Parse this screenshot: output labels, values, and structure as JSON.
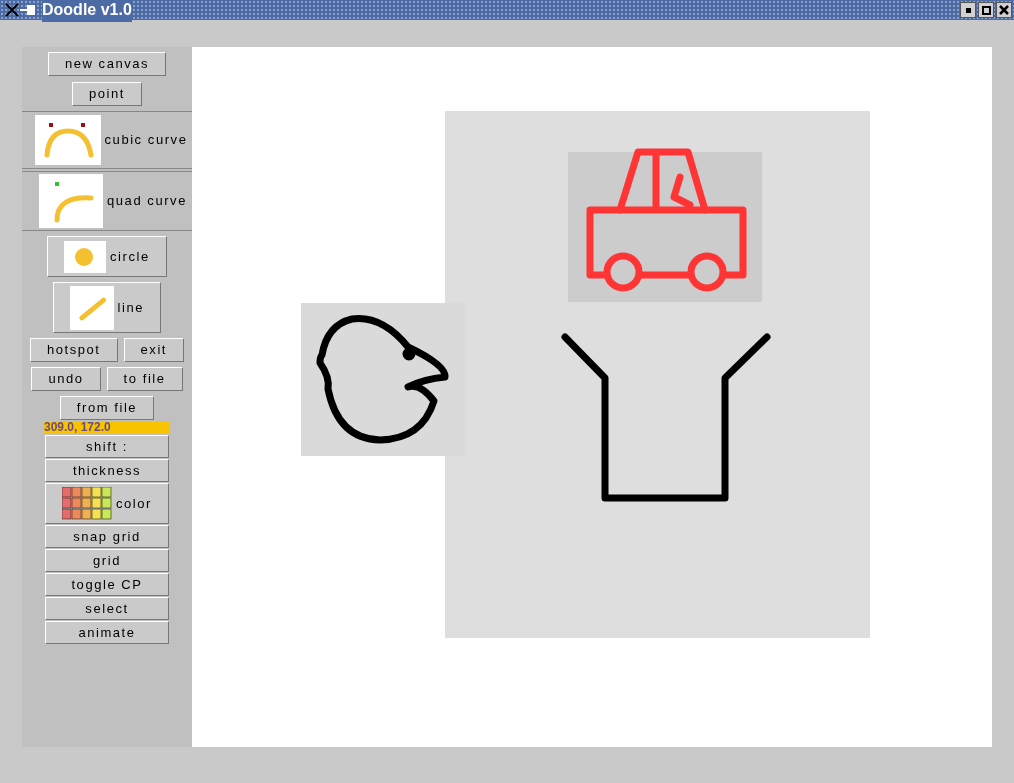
{
  "window": {
    "title": "Doodle v1.0"
  },
  "sidebar": {
    "groups": [
      [
        [
          {
            "kind": "button",
            "label": "new canvas"
          }
        ],
        [
          {
            "kind": "button",
            "label": "point"
          }
        ]
      ],
      [
        [
          {
            "kind": "cubic_tool",
            "label": "cubic curve"
          }
        ]
      ],
      [
        [
          {
            "kind": "quad_tool",
            "label": "quad curve"
          }
        ]
      ],
      [
        [
          {
            "kind": "circle_tool",
            "label": "circle"
          }
        ],
        [
          {
            "kind": "line_tool",
            "label": "line"
          }
        ],
        [
          {
            "kind": "button",
            "label": "hotspot"
          },
          {
            "kind": "button",
            "label": "exit"
          }
        ],
        [
          {
            "kind": "button",
            "label": "undo"
          },
          {
            "kind": "button",
            "label": "to file"
          }
        ],
        [
          {
            "kind": "button",
            "label": "from file"
          }
        ],
        [
          {
            "kind": "readout",
            "label": "309.0, 172.0"
          }
        ],
        [
          {
            "kind": "wide",
            "label": "shift :"
          }
        ],
        [
          {
            "kind": "wide",
            "label": "thickness"
          }
        ],
        [
          {
            "kind": "color_tool",
            "label": "color"
          }
        ],
        [
          {
            "kind": "wide",
            "label": "snap grid"
          }
        ],
        [
          {
            "kind": "wide",
            "label": "grid"
          }
        ],
        [
          {
            "kind": "wide",
            "label": "toggle CP"
          }
        ],
        [
          {
            "kind": "wide",
            "label": "select"
          }
        ],
        [
          {
            "kind": "wide",
            "label": "animate"
          }
        ]
      ]
    ]
  }
}
